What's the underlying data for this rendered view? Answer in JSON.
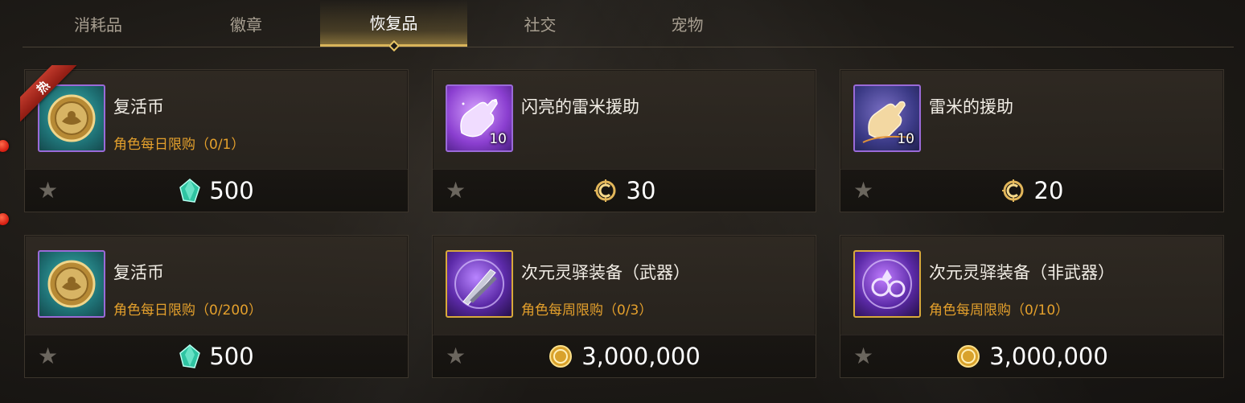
{
  "tabs": [
    {
      "label": "消耗品"
    },
    {
      "label": "徽章"
    },
    {
      "label": "恢复品"
    },
    {
      "label": "社交"
    },
    {
      "label": "宠物"
    }
  ],
  "active_tab": "恢复品",
  "items": [
    {
      "name": "复活币",
      "limit": "角色每日限购（0/1）",
      "price": "500",
      "currency": "gem-icon",
      "icon": "revive-coin-icon",
      "hot_badge": "热",
      "quantity": ""
    },
    {
      "name": "闪亮的雷米援助",
      "limit": "",
      "price": "30",
      "currency": "c-coin-icon",
      "icon": "glove-icon",
      "quantity": "10"
    },
    {
      "name": "雷米的援助",
      "limit": "",
      "price": "20",
      "currency": "c-coin-icon",
      "icon": "glove-icon",
      "quantity": "10"
    },
    {
      "name": "复活币",
      "limit": "角色每日限购（0/200）",
      "price": "500",
      "currency": "gem-icon",
      "icon": "revive-coin-icon",
      "quantity": ""
    },
    {
      "name": "次元灵驿装备（武器）",
      "limit": "角色每周限购（0/3）",
      "price": "3,000,000",
      "currency": "gold-coin-icon",
      "icon": "dimension-weapon-icon",
      "quantity": ""
    },
    {
      "name": "次元灵驿装备（非武器）",
      "limit": "角色每周限购（0/10）",
      "price": "3,000,000",
      "currency": "gold-coin-icon",
      "icon": "dimension-armor-icon",
      "quantity": ""
    }
  ],
  "colors": {
    "accent": "#d9b45a",
    "limit_text": "#e4a02c",
    "icon_border_purple": "#9a6ad8",
    "icon_border_gold": "#d8a93c",
    "notification_dot": "#d31b10"
  }
}
